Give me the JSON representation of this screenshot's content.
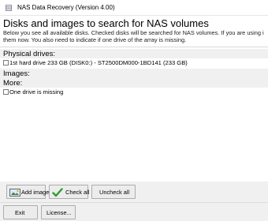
{
  "window": {
    "title": "NAS Data Recovery (Version 4.00)"
  },
  "header": {
    "heading": "Disks and images to search for NAS volumes",
    "description_line1": "Below you see all available disks. Checked disks will be searched for NAS volumes. If you are using i",
    "description_line2": "them now. You also need to indicate if one drive of the array is missing."
  },
  "sections": {
    "physical_drives": {
      "label": "Physical drives:",
      "items": [
        {
          "label": "1st hard drive 233 GB (DISK0:) - ST2500DM000-1BD141 (233 GB)",
          "checked": false
        }
      ]
    },
    "images": {
      "label": "Images:"
    },
    "more": {
      "label": "More:",
      "items": [
        {
          "label": "One drive is missing",
          "checked": false
        }
      ]
    }
  },
  "buttons": {
    "add_image": "Add image",
    "check_all": "Check all",
    "uncheck_all": "Uncheck all",
    "exit": "Exit",
    "license": "License..."
  },
  "colors": {
    "section_bg": "#f0f0f0",
    "button_bg": "#ececec",
    "button_border": "#adadad",
    "check_icon": "#2e9c2e"
  }
}
